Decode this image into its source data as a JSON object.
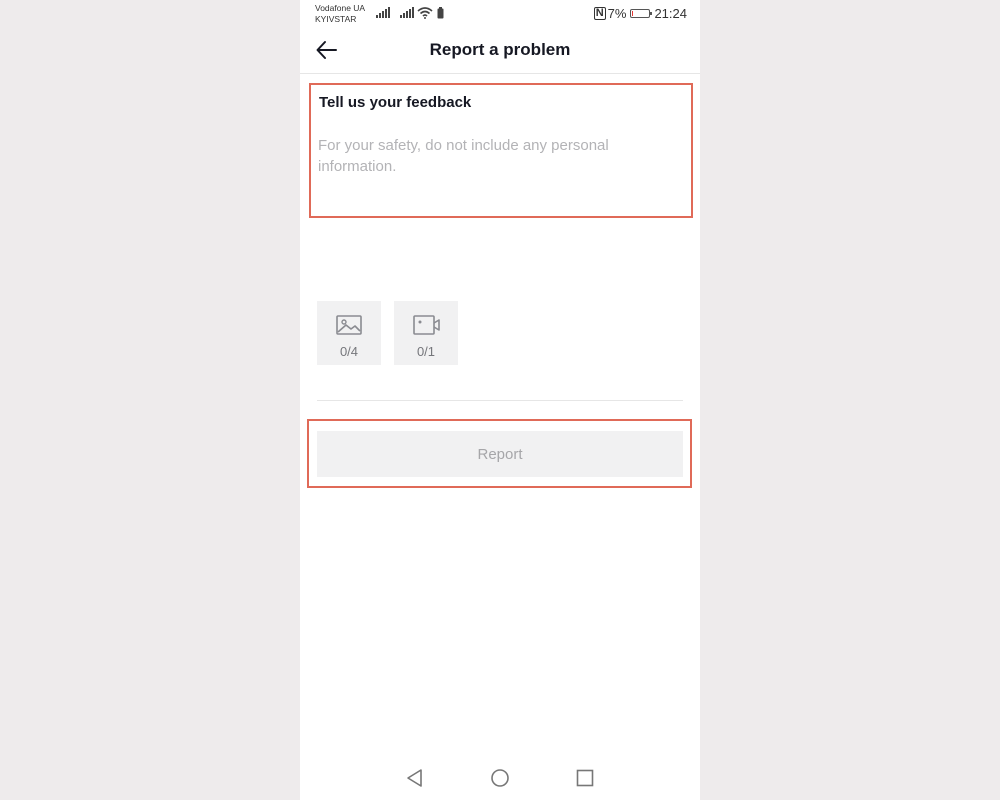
{
  "status_bar": {
    "carrier_1": "Vodafone UA",
    "carrier_2": "KYIVSTAR",
    "nfc": "N",
    "battery_text": "7%",
    "battery_level": 0.07,
    "battery_color": "#e53935",
    "time": "21:24"
  },
  "header": {
    "title": "Report a problem",
    "back_icon": "arrow-left-icon"
  },
  "feedback": {
    "label": "Tell us your feedback",
    "value": "",
    "placeholder": "For your safety, do not include any personal information."
  },
  "attachments": [
    {
      "icon": "image-icon",
      "count": "0/4"
    },
    {
      "icon": "video-icon",
      "count": "0/1"
    }
  ],
  "report_button": {
    "label": "Report",
    "enabled": false
  },
  "nav": {
    "back": "nav-back-icon",
    "home": "nav-home-icon",
    "recents": "nav-recents-icon"
  },
  "colors": {
    "highlight": "#e06a58",
    "background": "#eeebec",
    "button_bg": "#f1f1f2"
  }
}
